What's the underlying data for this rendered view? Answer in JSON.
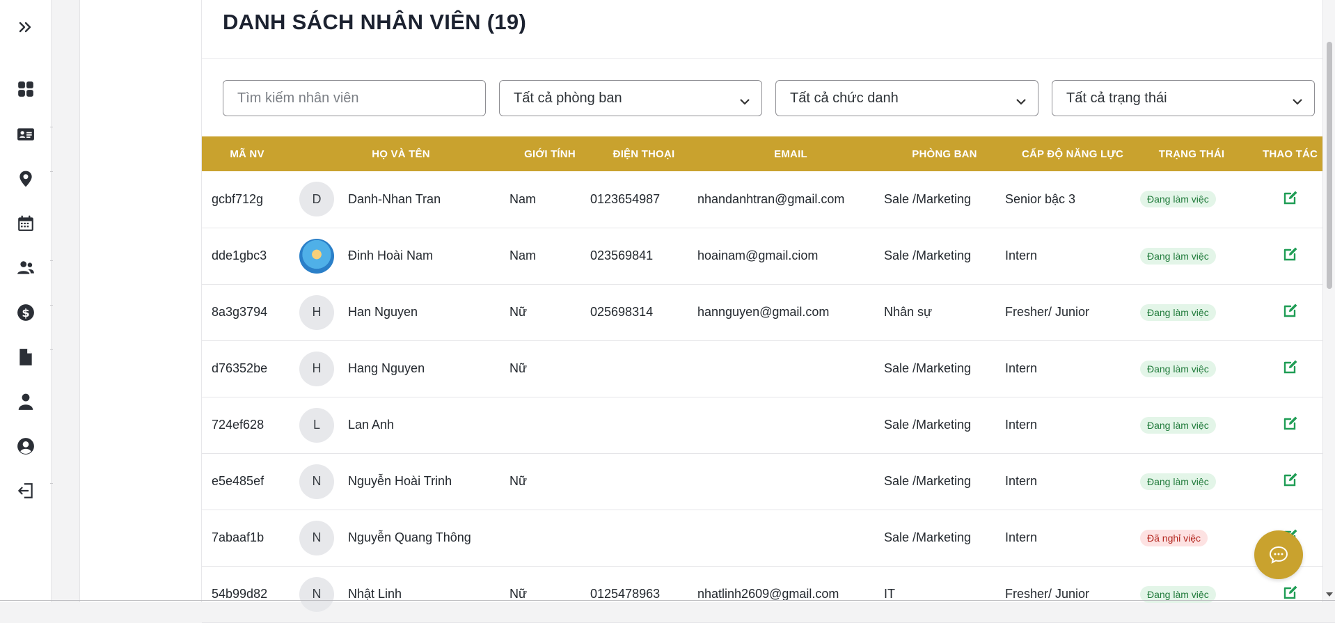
{
  "page": {
    "title": "DANH SÁCH NHÂN VIÊN (19)"
  },
  "sidebar": {
    "items": [
      {
        "icon": "dashboard-icon"
      },
      {
        "icon": "id-card-icon"
      },
      {
        "icon": "location-pin-icon"
      },
      {
        "icon": "calendar-icon"
      },
      {
        "icon": "users-icon"
      },
      {
        "icon": "dollar-icon"
      },
      {
        "icon": "document-icon"
      },
      {
        "icon": "user-icon"
      },
      {
        "icon": "user-circle-icon"
      },
      {
        "icon": "logout-icon"
      }
    ]
  },
  "filters": {
    "search_placeholder": "Tìm kiếm nhân viên",
    "department": "Tất cả phòng ban",
    "position": "Tất cả chức danh",
    "status": "Tất cả trạng thái"
  },
  "table": {
    "headers": {
      "id": "MÃ NV",
      "name": "HỌ VÀ TÊN",
      "gender": "GIỚI TÍNH",
      "phone": "ĐIỆN THOẠI",
      "email": "EMAIL",
      "department": "PHÒNG BAN",
      "level": "CẤP ĐỘ NĂNG LỰC",
      "status": "TRẠNG THÁI",
      "action": "THAO TÁC"
    },
    "rows": [
      {
        "id": "gcbf712g",
        "initial": "D",
        "name": "Danh-Nhan Tran",
        "gender": "Nam",
        "phone": "0123654987",
        "email": "nhandanhtran@gmail.com",
        "department": "Sale /Marketing",
        "level": "Senior bậc 3",
        "status": "Đang làm việc"
      },
      {
        "id": "dde1gbc3",
        "initial": "",
        "name": "Đinh Hoài Nam",
        "gender": "Nam",
        "phone": "023569841",
        "email": "hoainam@gmail.ciom",
        "department": "Sale /Marketing",
        "level": "Intern",
        "status": "Đang làm việc"
      },
      {
        "id": "8a3g3794",
        "initial": "H",
        "name": "Han Nguyen",
        "gender": "Nữ",
        "phone": "025698314",
        "email": "hannguyen@gmail.com",
        "department": "Nhân sự",
        "level": "Fresher/ Junior",
        "status": "Đang làm việc"
      },
      {
        "id": "d76352be",
        "initial": "H",
        "name": "Hang Nguyen",
        "gender": "Nữ",
        "phone": "",
        "email": "",
        "department": "Sale /Marketing",
        "level": "Intern",
        "status": "Đang làm việc"
      },
      {
        "id": "724ef628",
        "initial": "L",
        "name": "Lan Anh",
        "gender": "",
        "phone": "",
        "email": "",
        "department": "Sale /Marketing",
        "level": "Intern",
        "status": "Đang làm việc"
      },
      {
        "id": "e5e485ef",
        "initial": "N",
        "name": "Nguyễn Hoài Trinh",
        "gender": "Nữ",
        "phone": "",
        "email": "",
        "department": "Sale /Marketing",
        "level": "Intern",
        "status": "Đang làm việc"
      },
      {
        "id": "7abaaf1b",
        "initial": "N",
        "name": "Nguyễn Quang Thông",
        "gender": "",
        "phone": "",
        "email": "",
        "department": "Sale /Marketing",
        "level": "Intern",
        "status": "Đã nghỉ việc"
      },
      {
        "id": "54b99d82",
        "initial": "N",
        "name": "Nhật Linh",
        "gender": "Nữ",
        "phone": "0125478963",
        "email": "nhatlinh2609@gmail.com",
        "department": "IT",
        "level": "Fresher/ Junior",
        "status": "Đang làm việc"
      }
    ]
  },
  "colors": {
    "accent": "#c9a22e",
    "active_badge_bg": "#e3f5e8",
    "active_badge_text": "#1f7a3a",
    "inactive_badge_bg": "#fde2e2",
    "inactive_badge_text": "#b3261e",
    "edit_icon": "#1f9d55"
  }
}
